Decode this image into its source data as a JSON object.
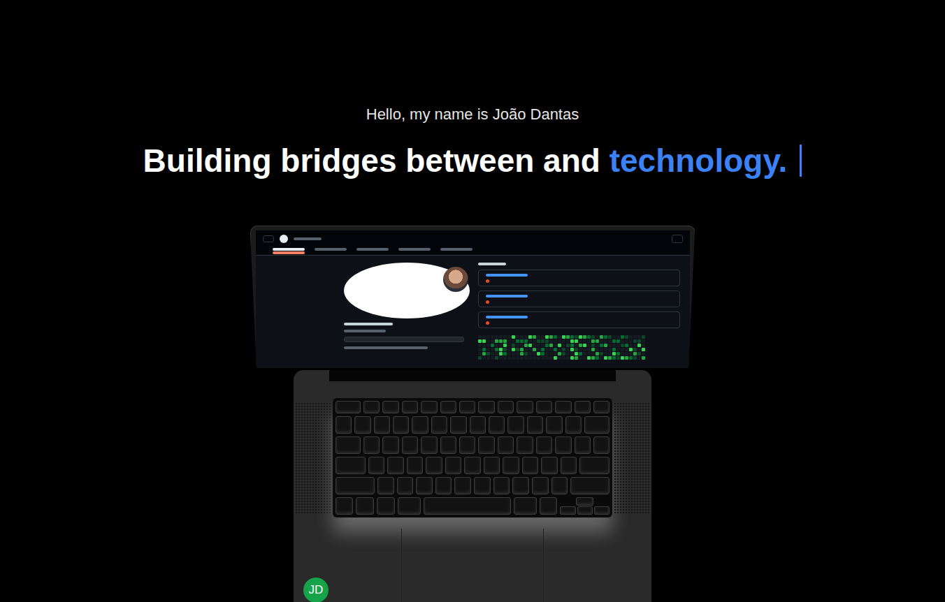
{
  "hero": {
    "greeting": "Hello, my name is João Dantas",
    "headline": "Building bridges between and ",
    "highlight": "technology.",
    "cursor_visible": true
  },
  "avatar_badge": {
    "initials": "JD"
  }
}
